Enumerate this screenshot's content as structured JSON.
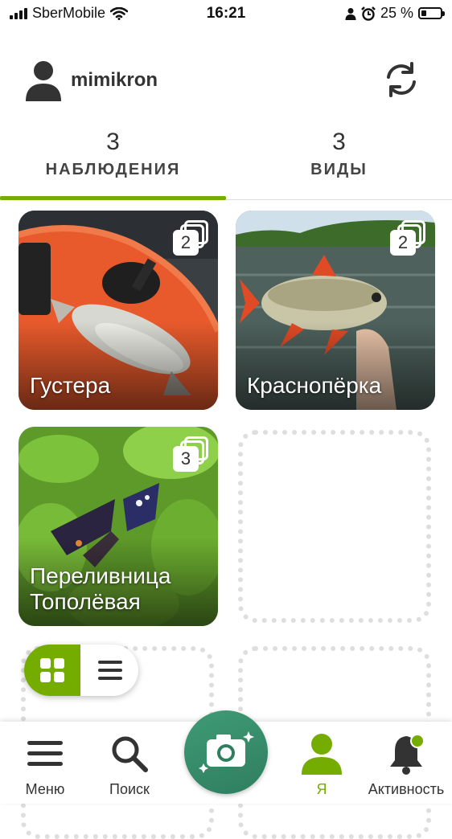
{
  "status_bar": {
    "carrier": "SberMobile",
    "time": "16:21",
    "battery_text": "25 %",
    "battery_level_percent": 25,
    "icons": [
      "signal-icon",
      "wifi-icon",
      "person-icon",
      "alarm-icon",
      "battery-icon"
    ]
  },
  "header": {
    "username": "mimikron",
    "avatar_icon": "person-icon",
    "sync_icon": "sync-icon"
  },
  "tabs": [
    {
      "count": "3",
      "label": "НАБЛЮДЕНИЯ",
      "active": true
    },
    {
      "count": "3",
      "label": "ВИДЫ",
      "active": false
    }
  ],
  "observations": [
    {
      "name": "Густера",
      "photo_count": "2"
    },
    {
      "name": "Краснопёрка",
      "photo_count": "2"
    },
    {
      "name": "Переливница\nТополёвая",
      "photo_count": "3"
    }
  ],
  "view_toggle": {
    "options": [
      "grid-view-icon",
      "list-view-icon"
    ],
    "selected": "grid-view-icon"
  },
  "bottom_nav": {
    "items": [
      {
        "label": "Меню",
        "icon": "menu-icon"
      },
      {
        "label": "Поиск",
        "icon": "search-icon"
      },
      {
        "label": "Я",
        "icon": "person-icon",
        "active": true
      },
      {
        "label": "Активность",
        "icon": "bell-icon"
      }
    ],
    "camera_icon": "camera-icon"
  },
  "colors": {
    "accent": "#74ac00",
    "camera_button": "#2f7e5f",
    "text": "#333333"
  }
}
